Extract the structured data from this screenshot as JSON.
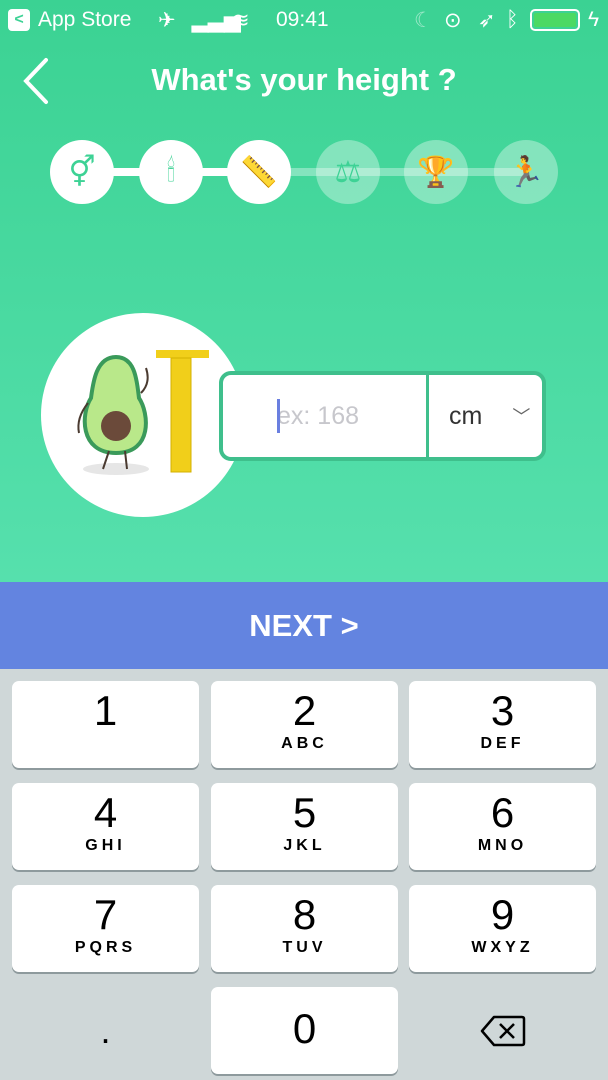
{
  "status_bar": {
    "back_app": "App Store",
    "time": "09:41",
    "battery_color": "#4cd964"
  },
  "header": {
    "title": "What's your height ?",
    "back_icon": "chevron-left-icon"
  },
  "steps": [
    {
      "icon": "gender-icon",
      "glyph": "⚥",
      "state": "done"
    },
    {
      "icon": "candle-icon",
      "glyph": "🕯",
      "state": "done"
    },
    {
      "icon": "ruler-icon",
      "glyph": "📏",
      "state": "current"
    },
    {
      "icon": "scale-icon",
      "glyph": "⚖",
      "state": "todo"
    },
    {
      "icon": "trophy-icon",
      "glyph": "🏆",
      "state": "todo"
    },
    {
      "icon": "running-icon",
      "glyph": "🏃",
      "state": "todo"
    }
  ],
  "height_input": {
    "value": "",
    "placeholder": "ex: 168",
    "unit": "cm"
  },
  "next_label": "NEXT >",
  "keypad": [
    {
      "n": "1",
      "l": ""
    },
    {
      "n": "2",
      "l": "ABC"
    },
    {
      "n": "3",
      "l": "DEF"
    },
    {
      "n": "4",
      "l": "GHI"
    },
    {
      "n": "5",
      "l": "JKL"
    },
    {
      "n": "6",
      "l": "MNO"
    },
    {
      "n": "7",
      "l": "PQRS"
    },
    {
      "n": "8",
      "l": "TUV"
    },
    {
      "n": "9",
      "l": "WXYZ"
    },
    {
      "n": ".",
      "l": ""
    },
    {
      "n": "0",
      "l": ""
    },
    {
      "n": "delete",
      "l": ""
    }
  ],
  "colors": {
    "primary": "#3dd295",
    "next": "#6384e0"
  }
}
